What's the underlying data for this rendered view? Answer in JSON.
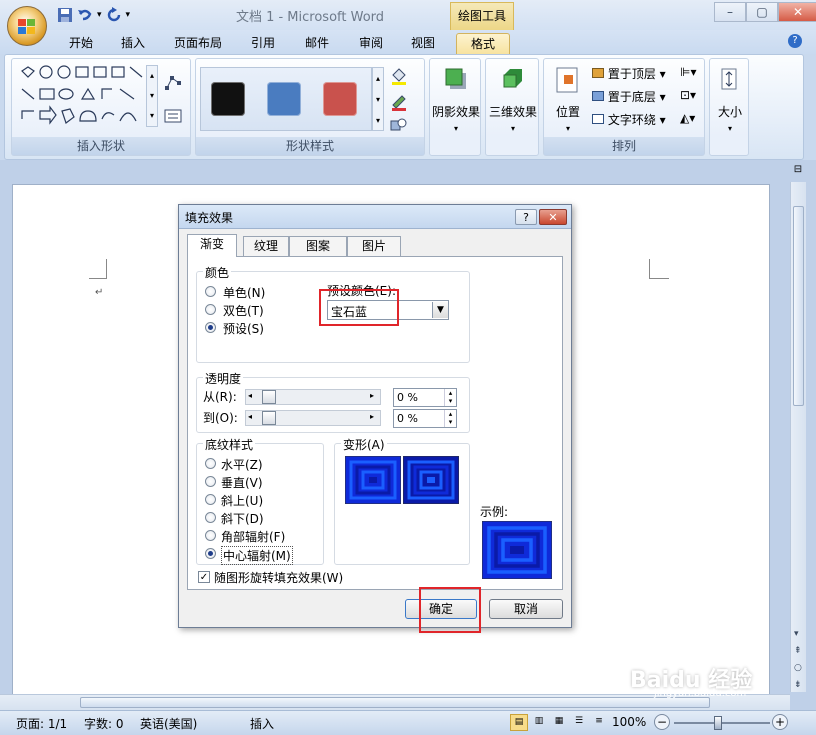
{
  "window": {
    "title": "文档 1 - Microsoft Word",
    "context_tab_group": "绘图工具",
    "min": "–",
    "max": "▢",
    "close": "✕"
  },
  "ribbon": {
    "tabs": [
      "开始",
      "插入",
      "页面布局",
      "引用",
      "邮件",
      "审阅",
      "视图",
      "格式"
    ],
    "active_tab": "格式",
    "groups": {
      "insert_shapes": "插入形状",
      "shape_styles": "形状样式",
      "shadow_effects": "阴影效果",
      "3d_effects": "三维效果",
      "arrange": "排列",
      "size": "大小"
    },
    "arrange_items": [
      "位置",
      "置于顶层",
      "置于底层",
      "文字环绕"
    ],
    "swatch_colors": [
      "#111111",
      "#4a7cc0",
      "#c9524d"
    ]
  },
  "dialog": {
    "title": "填充效果",
    "help": "?",
    "close": "✕",
    "tabs": [
      "渐变",
      "纹理",
      "图案",
      "图片"
    ],
    "active_tab": "渐变",
    "colors_group": {
      "legend": "颜色",
      "options": [
        "单色(N)",
        "双色(T)",
        "预设(S)"
      ],
      "selected": "预设(S)",
      "preset_label": "预设颜色(E):",
      "preset_value": "宝石蓝"
    },
    "transparency": {
      "legend": "透明度",
      "from_label": "从(R):",
      "to_label": "到(O):",
      "from_value": "0 %",
      "to_value": "0 %"
    },
    "shading": {
      "legend": "底纹样式",
      "options": [
        "水平(Z)",
        "垂直(V)",
        "斜上(U)",
        "斜下(D)",
        "角部辐射(F)",
        "中心辐射(M)"
      ],
      "selected": "中心辐射(M)"
    },
    "variants_label": "变形(A)",
    "sample_label": "示例:",
    "rotate_checkbox": "随图形旋转填充效果(W)",
    "ok": "确定",
    "cancel": "取消"
  },
  "statusbar": {
    "page": "页面: 1/1",
    "words": "字数: 0",
    "language": "英语(美国)",
    "mode": "插入",
    "zoom": "100%"
  },
  "watermark": "Baidu 经验",
  "watermark_url": "jingyan.baidu.com"
}
